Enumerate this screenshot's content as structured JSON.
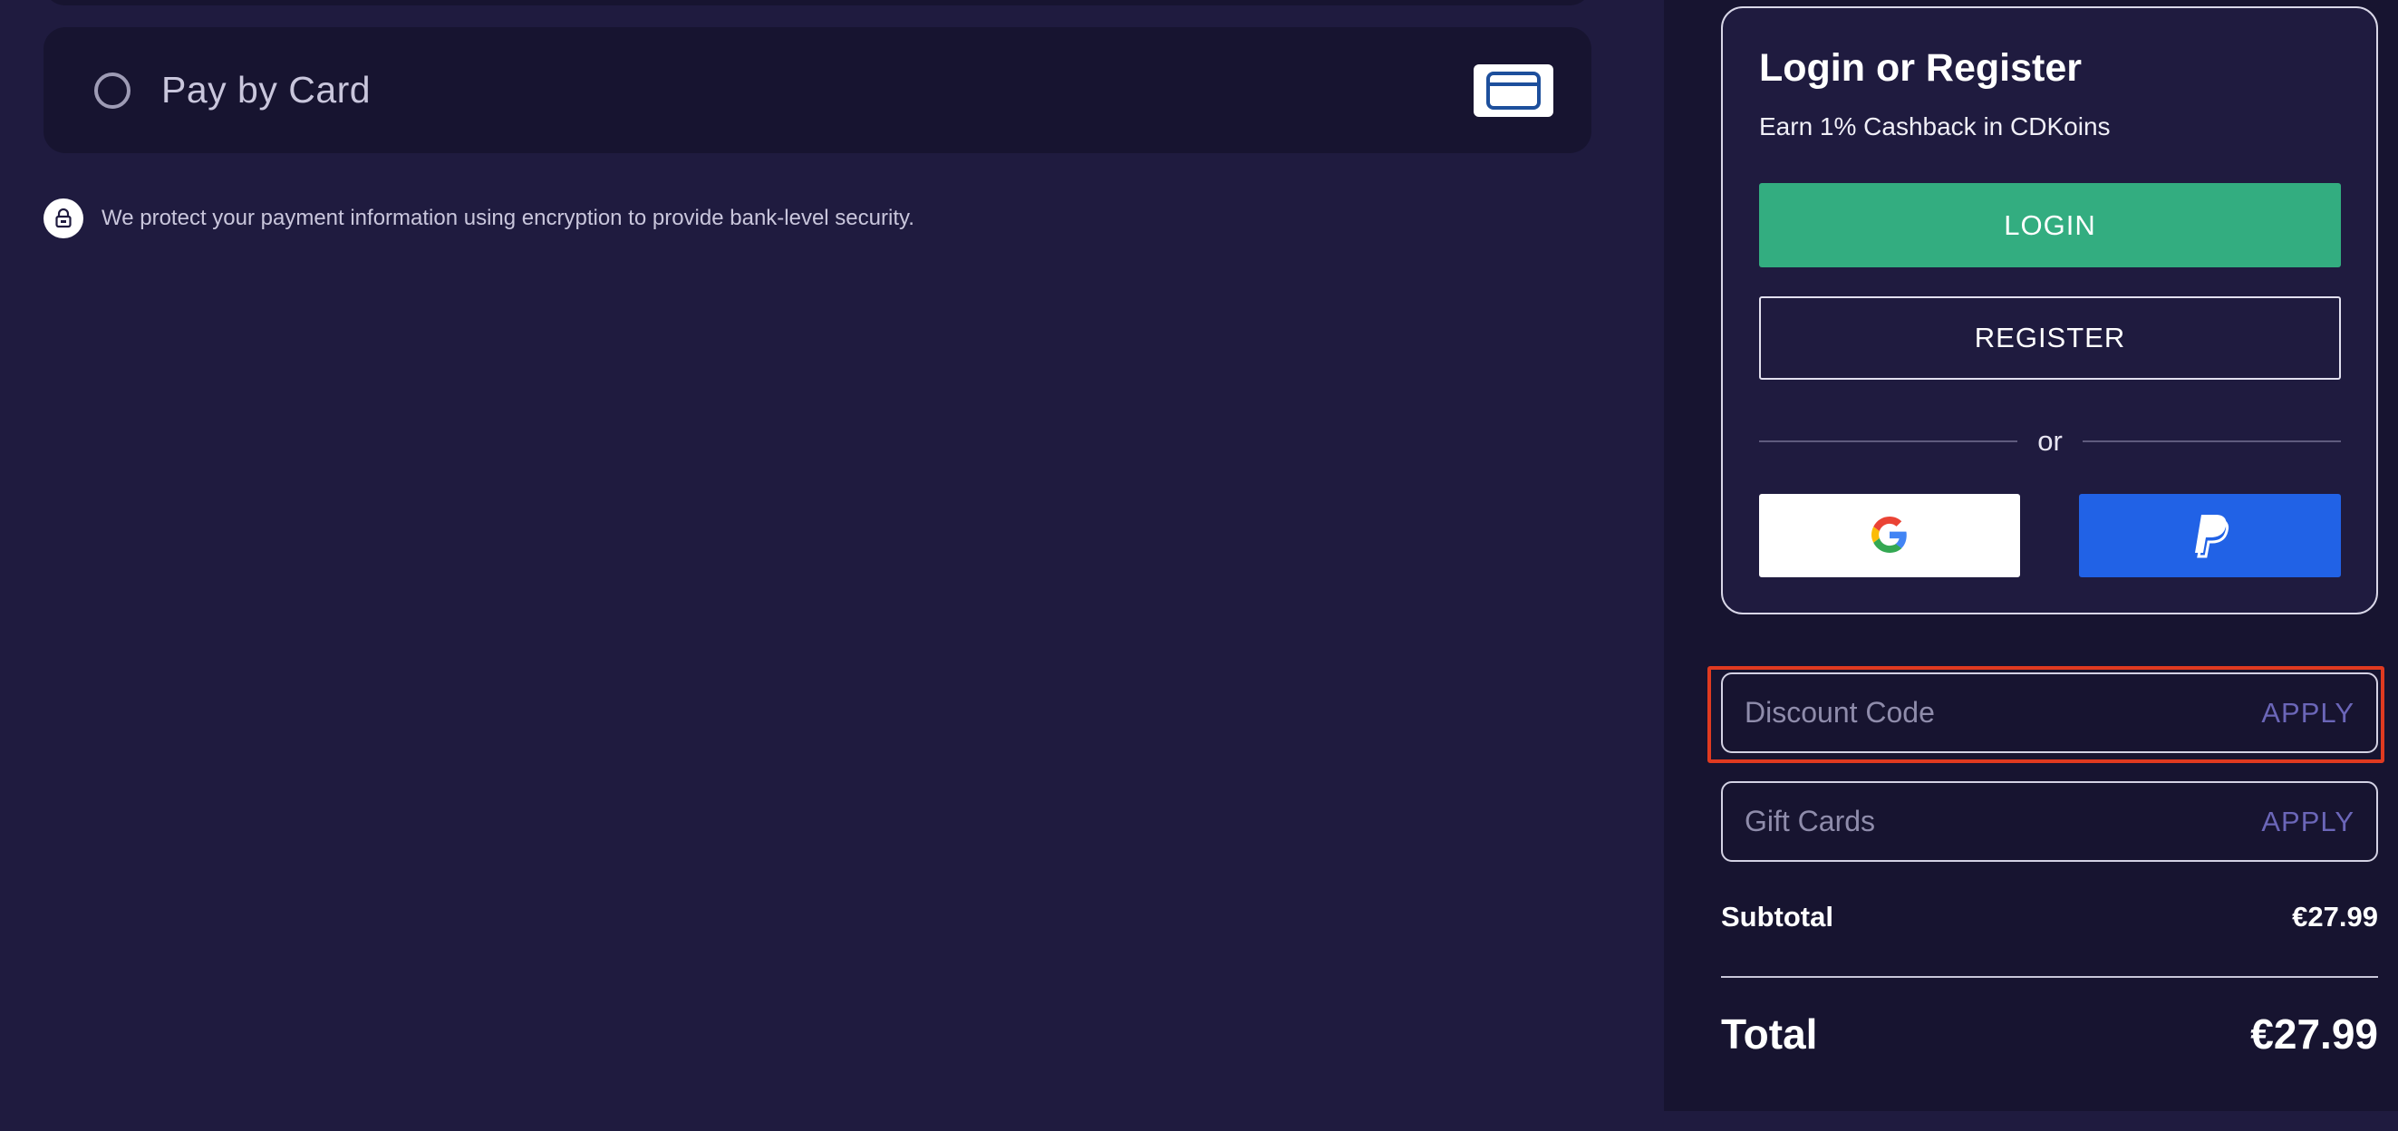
{
  "payment": {
    "option_label": "Pay by Card",
    "security_note": "We protect your payment information using encryption to provide bank-level security."
  },
  "login_box": {
    "title": "Login or Register",
    "subtitle": "Earn 1% Cashback in CDKoins",
    "login_label": "LOGIN",
    "register_label": "REGISTER",
    "divider_text": "or",
    "social_buttons": [
      "google-icon",
      "paypal-icon"
    ]
  },
  "discount": {
    "placeholder": "Discount Code",
    "value": "",
    "apply_label": "APPLY"
  },
  "gift_cards": {
    "placeholder": "Gift Cards",
    "value": "",
    "apply_label": "APPLY"
  },
  "totals": {
    "subtotal_label": "Subtotal",
    "subtotal_value": "€27.99",
    "total_label": "Total",
    "total_value": "€27.99"
  },
  "colors": {
    "page_bg": "#1f1b3f",
    "panel_bg": "#171430",
    "login_green": "#33ad80",
    "paypal_blue": "#2162e6",
    "apply_purple": "#6b66b8",
    "highlight_red": "#e03a20"
  }
}
